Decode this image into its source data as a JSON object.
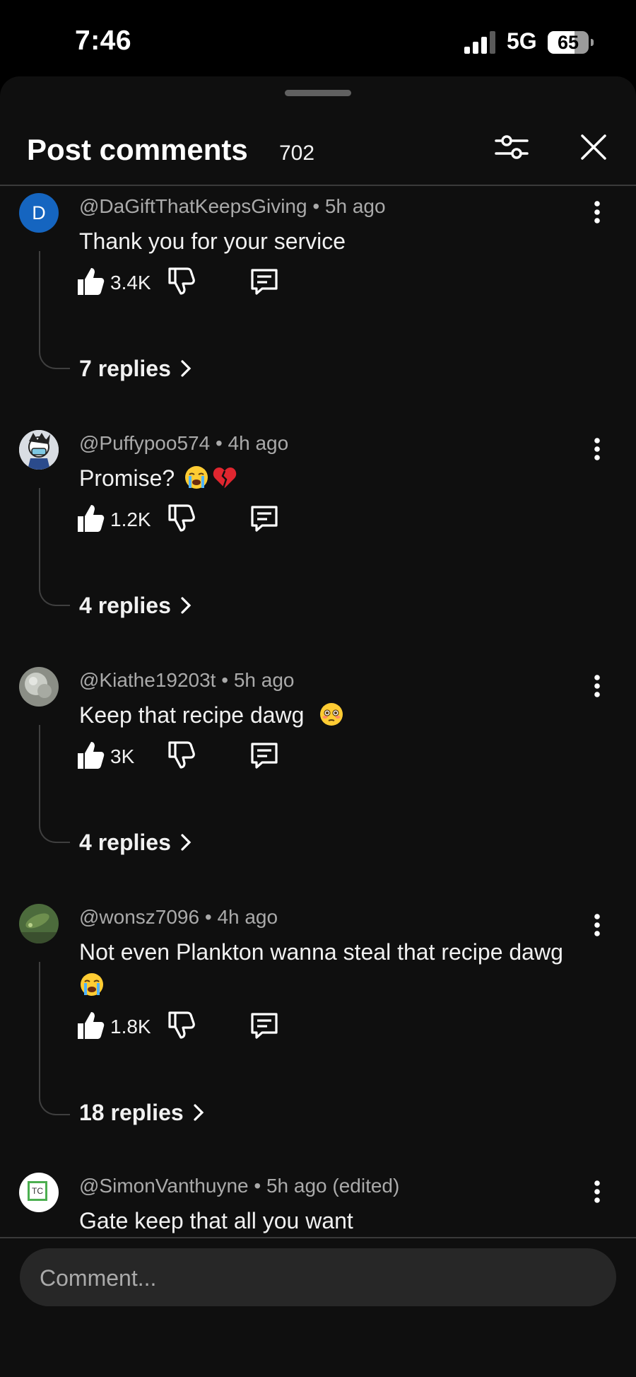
{
  "status_bar": {
    "time": "7:46",
    "network": "5G",
    "battery": "65",
    "battery_level": 0.65
  },
  "header": {
    "title": "Post comments",
    "count": "702"
  },
  "comments": [
    {
      "meta": "@DaGiftThatKeepsGiving • 5h ago",
      "text": "Thank you for your service",
      "emojis": [],
      "likes": "3.4K",
      "replies": "7 replies",
      "avatar_letter": "D"
    },
    {
      "meta": "@Puffypoo574 • 4h ago",
      "text": "Promise?",
      "emojis": [
        "loudly-crying-face",
        "broken-heart"
      ],
      "likes": "1.2K",
      "replies": "4 replies"
    },
    {
      "meta": "@Kiathe19203t • 5h ago",
      "text": "Keep that recipe dawg",
      "emojis": [
        "flushed-face"
      ],
      "likes": "3K",
      "replies": "4 replies"
    },
    {
      "meta": "@wonsz7096 • 4h ago",
      "text": "Not even Plankton wanna steal that recipe dawg",
      "emojis": [
        "loudly-crying-face"
      ],
      "likes": "1.8K",
      "replies": "18 replies"
    },
    {
      "meta": "@SimonVanthuyne • 5h ago (edited)",
      "text": "Gate keep that all you want",
      "emojis": [],
      "avatar_text": "TC"
    }
  ],
  "composer": {
    "placeholder": "Comment..."
  },
  "colors": {
    "background": "#0f0f0f",
    "avatar_blue": "#1565c0",
    "secondary_text": "#aaaaaa"
  }
}
